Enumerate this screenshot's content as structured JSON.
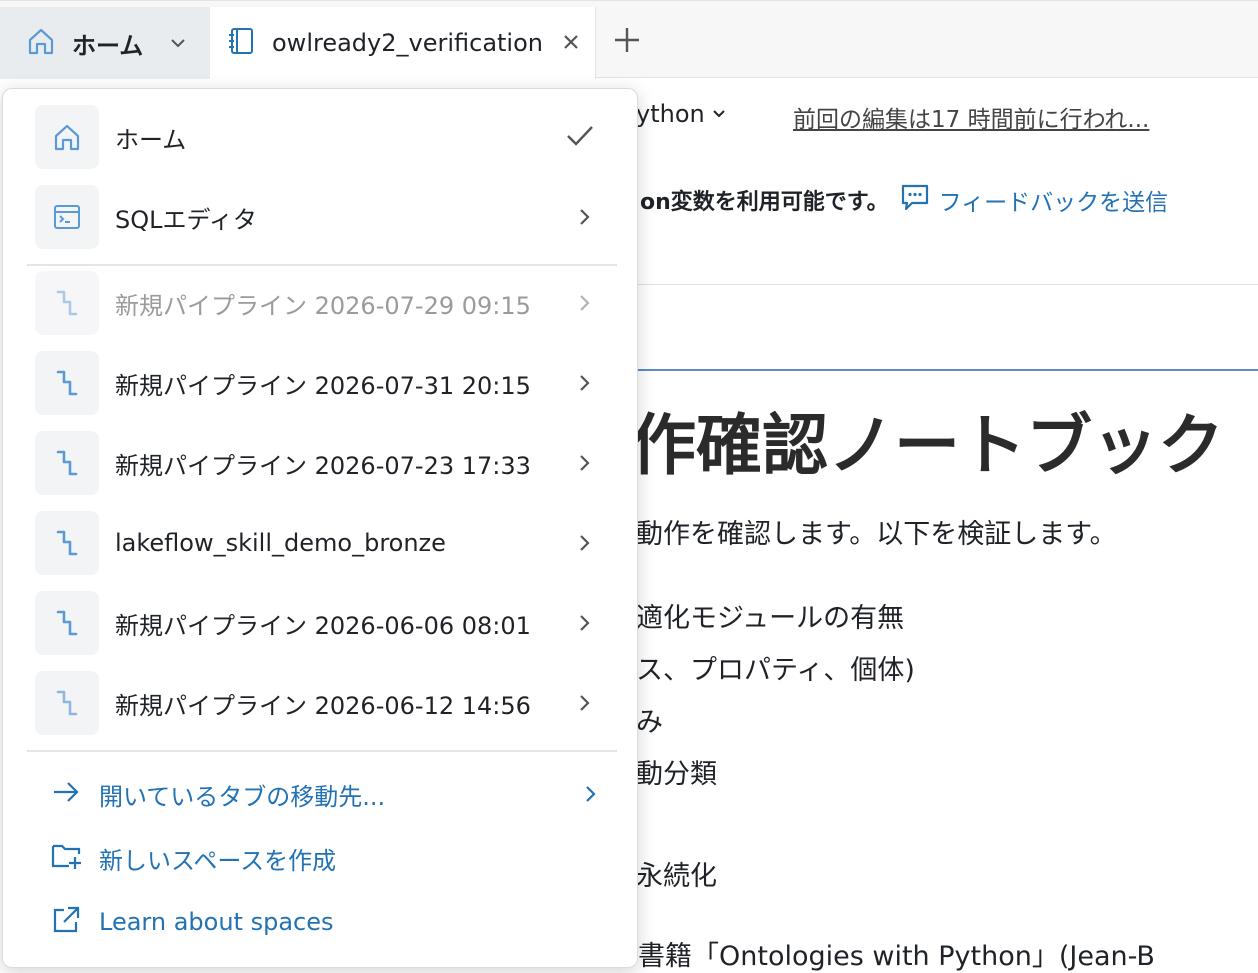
{
  "tabs": {
    "home_label": "ホーム",
    "notebook_label": "owlready2_verification"
  },
  "notebook": {
    "language": "ython",
    "last_edit": "前回の編集は17 時間前に行われ...",
    "banner_text": "on変数を利用可能です。",
    "feedback_link": "フィードバックを送信",
    "title": "作確認ノートブック",
    "lines": [
      "動作を確認します。以下を検証します。",
      "適化モジュールの有無",
      "ス、プロパティ、個体)",
      "み",
      "動分類",
      "永続化"
    ],
    "reference": "書籍「Ontologies with Python」(Jean-B"
  },
  "menu": {
    "items": [
      {
        "label": "ホーム"
      },
      {
        "label": "SQLエディタ"
      }
    ],
    "recent": [
      {
        "label": "新規パイプライン 2026-07-29 09:15"
      },
      {
        "label": "新規パイプライン 2026-07-31 20:15"
      },
      {
        "label": "新規パイプライン 2026-07-23 17:33"
      },
      {
        "label": "lakeflow_skill_demo_bronze"
      },
      {
        "label": "新規パイプライン 2026-06-06 08:01"
      },
      {
        "label": "新規パイプライン 2026-06-12 14:56"
      }
    ],
    "actions": {
      "move_tabs": "開いているタブの移動先...",
      "new_space": "新しいスペースを作成",
      "learn_spaces": "Learn about spaces"
    }
  },
  "colors": {
    "accent": "#2272b4",
    "icon_blue": "#5b9bd5"
  }
}
